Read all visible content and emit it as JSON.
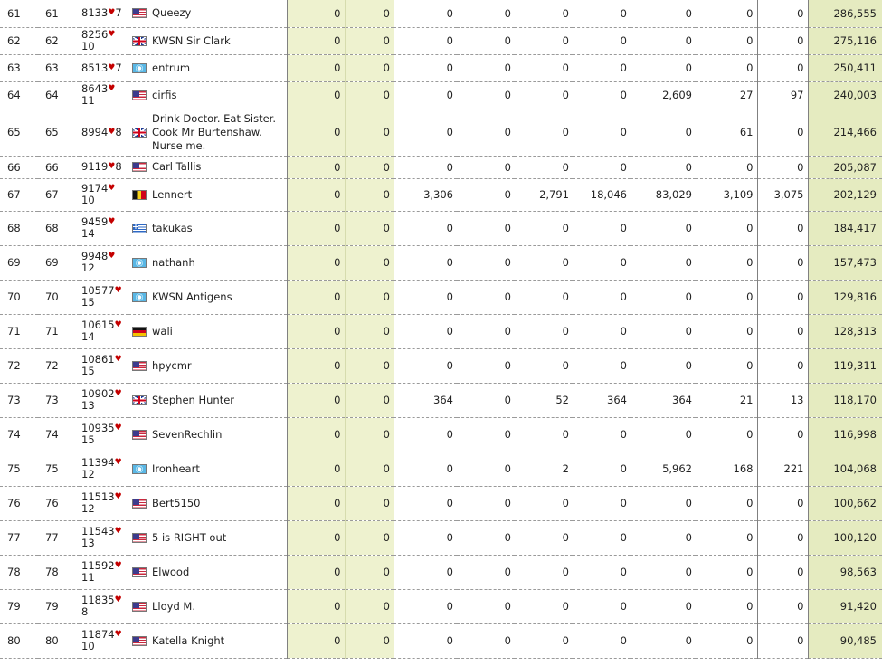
{
  "rows": [
    {
      "rank": "61",
      "rank2": "61",
      "num": "8133",
      "sub": "7",
      "inline": true,
      "flag": "us",
      "name": "Queezy",
      "vals": [
        "0",
        "0",
        "0",
        "0",
        "0",
        "0",
        "0",
        "0",
        "0"
      ],
      "total": "286,555"
    },
    {
      "rank": "62",
      "rank2": "62",
      "num": "8256",
      "sub": "10",
      "inline": false,
      "flag": "gb",
      "name": "KWSN Sir Clark",
      "vals": [
        "0",
        "0",
        "0",
        "0",
        "0",
        "0",
        "0",
        "0",
        "0"
      ],
      "total": "275,116"
    },
    {
      "rank": "63",
      "rank2": "63",
      "num": "8513",
      "sub": "7",
      "inline": true,
      "flag": "un",
      "name": "entrum",
      "vals": [
        "0",
        "0",
        "0",
        "0",
        "0",
        "0",
        "0",
        "0",
        "0"
      ],
      "total": "250,411"
    },
    {
      "rank": "64",
      "rank2": "64",
      "num": "8643",
      "sub": "11",
      "inline": false,
      "flag": "us",
      "name": "cirfis",
      "vals": [
        "0",
        "0",
        "0",
        "0",
        "0",
        "0",
        "2,609",
        "27",
        "97"
      ],
      "total": "240,003"
    },
    {
      "rank": "65",
      "rank2": "65",
      "num": "8994",
      "sub": "8",
      "inline": true,
      "flag": "gb",
      "name": "Drink Doctor. Eat Sister. Cook Mr Burtenshaw. Nurse me.",
      "vals": [
        "0",
        "0",
        "0",
        "0",
        "0",
        "0",
        "0",
        "61",
        "0"
      ],
      "total": "214,466"
    },
    {
      "rank": "66",
      "rank2": "66",
      "num": "9119",
      "sub": "8",
      "inline": true,
      "flag": "us",
      "name": "Carl Tallis",
      "vals": [
        "0",
        "0",
        "0",
        "0",
        "0",
        "0",
        "0",
        "0",
        "0"
      ],
      "total": "205,087"
    },
    {
      "rank": "67",
      "rank2": "67",
      "num": "9174",
      "sub": "10",
      "inline": false,
      "flag": "be",
      "name": "Lennert",
      "vals": [
        "0",
        "0",
        "3,306",
        "0",
        "2,791",
        "18,046",
        "83,029",
        "3,109",
        "3,075"
      ],
      "total": "202,129"
    },
    {
      "rank": "68",
      "rank2": "68",
      "num": "9459",
      "sub": "14",
      "inline": false,
      "flag": "gr",
      "name": "takukas",
      "vals": [
        "0",
        "0",
        "0",
        "0",
        "0",
        "0",
        "0",
        "0",
        "0"
      ],
      "total": "184,417"
    },
    {
      "rank": "69",
      "rank2": "69",
      "num": "9948",
      "sub": "12",
      "inline": false,
      "flag": "un",
      "name": "nathanh",
      "vals": [
        "0",
        "0",
        "0",
        "0",
        "0",
        "0",
        "0",
        "0",
        "0"
      ],
      "total": "157,473"
    },
    {
      "rank": "70",
      "rank2": "70",
      "num": "10577",
      "sub": "15",
      "inline": false,
      "flag": "un",
      "name": "KWSN Antigens",
      "vals": [
        "0",
        "0",
        "0",
        "0",
        "0",
        "0",
        "0",
        "0",
        "0"
      ],
      "total": "129,816"
    },
    {
      "rank": "71",
      "rank2": "71",
      "num": "10615",
      "sub": "14",
      "inline": false,
      "flag": "de",
      "name": "wali",
      "vals": [
        "0",
        "0",
        "0",
        "0",
        "0",
        "0",
        "0",
        "0",
        "0"
      ],
      "total": "128,313"
    },
    {
      "rank": "72",
      "rank2": "72",
      "num": "10861",
      "sub": "15",
      "inline": false,
      "flag": "us",
      "name": "hpycmr",
      "vals": [
        "0",
        "0",
        "0",
        "0",
        "0",
        "0",
        "0",
        "0",
        "0"
      ],
      "total": "119,311"
    },
    {
      "rank": "73",
      "rank2": "73",
      "num": "10902",
      "sub": "13",
      "inline": false,
      "flag": "gb",
      "name": "Stephen Hunter",
      "vals": [
        "0",
        "0",
        "364",
        "0",
        "52",
        "364",
        "364",
        "21",
        "13"
      ],
      "total": "118,170"
    },
    {
      "rank": "74",
      "rank2": "74",
      "num": "10935",
      "sub": "15",
      "inline": false,
      "flag": "us",
      "name": "SevenRechlin",
      "vals": [
        "0",
        "0",
        "0",
        "0",
        "0",
        "0",
        "0",
        "0",
        "0"
      ],
      "total": "116,998"
    },
    {
      "rank": "75",
      "rank2": "75",
      "num": "11394",
      "sub": "12",
      "inline": false,
      "flag": "un",
      "name": "Ironheart",
      "vals": [
        "0",
        "0",
        "0",
        "0",
        "2",
        "0",
        "5,962",
        "168",
        "221"
      ],
      "total": "104,068"
    },
    {
      "rank": "76",
      "rank2": "76",
      "num": "11513",
      "sub": "12",
      "inline": false,
      "flag": "us",
      "name": "Bert5150",
      "vals": [
        "0",
        "0",
        "0",
        "0",
        "0",
        "0",
        "0",
        "0",
        "0"
      ],
      "total": "100,662"
    },
    {
      "rank": "77",
      "rank2": "77",
      "num": "11543",
      "sub": "13",
      "inline": false,
      "flag": "us",
      "name": "5 is RIGHT out",
      "vals": [
        "0",
        "0",
        "0",
        "0",
        "0",
        "0",
        "0",
        "0",
        "0"
      ],
      "total": "100,120"
    },
    {
      "rank": "78",
      "rank2": "78",
      "num": "11592",
      "sub": "11",
      "inline": false,
      "flag": "us",
      "name": "Elwood",
      "vals": [
        "0",
        "0",
        "0",
        "0",
        "0",
        "0",
        "0",
        "0",
        "0"
      ],
      "total": "98,563"
    },
    {
      "rank": "79",
      "rank2": "79",
      "num": "11835",
      "sub": "8",
      "inline": false,
      "flag": "us",
      "name": "Lloyd M.",
      "vals": [
        "0",
        "0",
        "0",
        "0",
        "0",
        "0",
        "0",
        "0",
        "0"
      ],
      "total": "91,420"
    },
    {
      "rank": "80",
      "rank2": "80",
      "num": "11874",
      "sub": "10",
      "inline": false,
      "flag": "us",
      "name": "Katella Knight",
      "vals": [
        "0",
        "0",
        "0",
        "0",
        "0",
        "0",
        "0",
        "0",
        "0"
      ],
      "total": "90,485"
    }
  ],
  "heart_icon": "heart-icon",
  "colors": {
    "highlight": "#eef2cf",
    "total_bg": "#e5ebc0",
    "heart": "#c40000"
  }
}
